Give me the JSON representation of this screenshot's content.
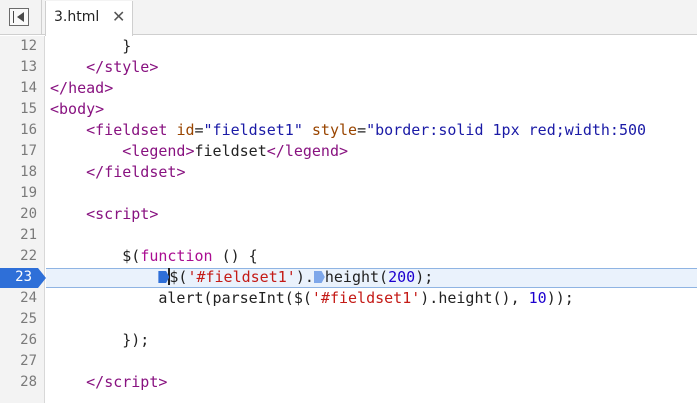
{
  "tab": {
    "title": "3.html",
    "close_glyph": "✕"
  },
  "gutter": {
    "line_numbers": [
      "12",
      "13",
      "14",
      "15",
      "16",
      "17",
      "18",
      "19",
      "20",
      "21",
      "22",
      "23",
      "24",
      "25",
      "26",
      "27",
      "28"
    ],
    "active_line": "23"
  },
  "code": {
    "l12_brace": "}",
    "l13_close": "</",
    "l13_tag": "style",
    "l13_gt": ">",
    "l14_close": "</",
    "l14_tag": "head",
    "l14_gt": ">",
    "l15_open": "<",
    "l15_tag": "body",
    "l15_gt": ">",
    "l16_open": "<",
    "l16_tag": "fieldset",
    "l16_attr1": "id",
    "l16_eq1": "=",
    "l16_val1": "\"fieldset1\"",
    "l16_attr2": "style",
    "l16_eq2": "=",
    "l16_val2": "\"border:solid 1px red;width:500",
    "l17_open": "<",
    "l17_tag": "legend",
    "l17_gt": ">",
    "l17_text": "fieldset",
    "l17_close": "</",
    "l17_tag2": "legend",
    "l17_gt2": ">",
    "l18_close": "</",
    "l18_tag": "fieldset",
    "l18_gt": ">",
    "l20_open": "<",
    "l20_tag": "script",
    "l20_gt": ">",
    "l22_a": "$(",
    "l22_kw": "function",
    "l22_b": " () {",
    "l23_a": "$(",
    "l23_str": "'#fieldset1'",
    "l23_b": ").",
    "l23_c": "height(",
    "l23_num": "200",
    "l23_d": ");",
    "l24_a": "alert(parseInt($(",
    "l24_str": "'#fieldset1'",
    "l24_b": ").height(), ",
    "l24_num": "10",
    "l24_c": "));",
    "l26_a": "});",
    "l28_close": "</",
    "l28_tag": "script",
    "l28_gt": ">"
  },
  "colors": {
    "tag": "#881280",
    "attribute": "#994500",
    "attribute_value": "#1a1aa6",
    "string": "#c41a16",
    "keyword": "#aa0d91",
    "number": "#1c00cf",
    "breakpoint": "#2e6fd8",
    "current_line_bg": "#eaf2fc"
  }
}
